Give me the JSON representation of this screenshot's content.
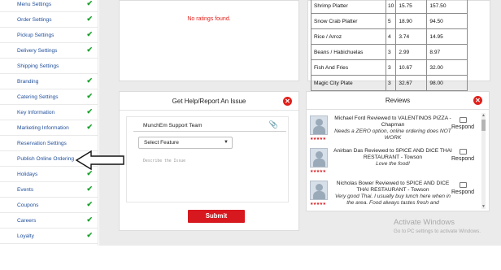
{
  "sidebar": {
    "items": [
      {
        "label": "Menu Settings",
        "checked": true
      },
      {
        "label": "Order Settings",
        "checked": true
      },
      {
        "label": "Pickup Settings",
        "checked": true
      },
      {
        "label": "Delivery Settings",
        "checked": true
      },
      {
        "label": "Shipping Settings",
        "checked": false
      },
      {
        "label": "Branding",
        "checked": true
      },
      {
        "label": "Catering Settings",
        "checked": true
      },
      {
        "label": "Key Information",
        "checked": true
      },
      {
        "label": "Marketing Information",
        "checked": true
      },
      {
        "label": "Reservation Settings",
        "checked": false
      },
      {
        "label": "Publish Online Ordering",
        "checked": false
      },
      {
        "label": "Holidays",
        "checked": true
      },
      {
        "label": "Events",
        "checked": true
      },
      {
        "label": "Coupons",
        "checked": true
      },
      {
        "label": "Careers",
        "checked": true
      },
      {
        "label": "Loyalty",
        "checked": true
      }
    ],
    "check_color": "#1aa12c",
    "label_color": "#1f4e9a"
  },
  "ratings": {
    "empty_text": "No ratings found."
  },
  "menu_table": {
    "rows": [
      {
        "name": "Shrimp Platter",
        "qty": "10",
        "price": "15.75",
        "total": "157.50"
      },
      {
        "name": "Snow Crab Platter",
        "qty": "5",
        "price": "18.90",
        "total": "94.50"
      },
      {
        "name": "Rice / Arroz",
        "qty": "4",
        "price": "3.74",
        "total": "14.95"
      },
      {
        "name": "Beans / Habichuelas",
        "qty": "3",
        "price": "2.99",
        "total": "8.97"
      },
      {
        "name": "Fish And Fries",
        "qty": "3",
        "price": "10.67",
        "total": "32.00"
      },
      {
        "name": "Magic City Plate",
        "qty": "3",
        "price": "32.67",
        "total": "98.00"
      }
    ]
  },
  "help": {
    "title": "Get Help/Report An Issue",
    "team": "MunchEm Support Team",
    "select_placeholder": "Select Feature",
    "describe_placeholder": "Describe the Issue",
    "submit_label": "Submit",
    "accent": "#d7191f"
  },
  "reviews": {
    "title": "Reviews",
    "respond_label": "Respond",
    "items": [
      {
        "header": "Michael Ford Reviewed to VALENTINOS PIZZA - Chapman",
        "comment": "Needs a ZERO option, online ordering does NOT WORK"
      },
      {
        "header": "Anirban Das Reviewed to SPICE AND DICE THAI RESTAURANT - Towson",
        "comment": "Love the food!"
      },
      {
        "header": "Nicholas Bower Reviewed to SPICE AND DICE THAI RESTAURANT - Towson",
        "comment": "Very good Thai. I usually buy lunch here when in the area. Food always tastes fresh and"
      }
    ]
  },
  "watermark": {
    "line1": "Activate Windows",
    "line2": "Go to PC settings to activate Windows."
  },
  "icons": {
    "check": "check-icon",
    "close": "close-icon",
    "attach": "paperclip-icon",
    "respond": "chat-icon",
    "annotation": "arrow-left-icon"
  }
}
